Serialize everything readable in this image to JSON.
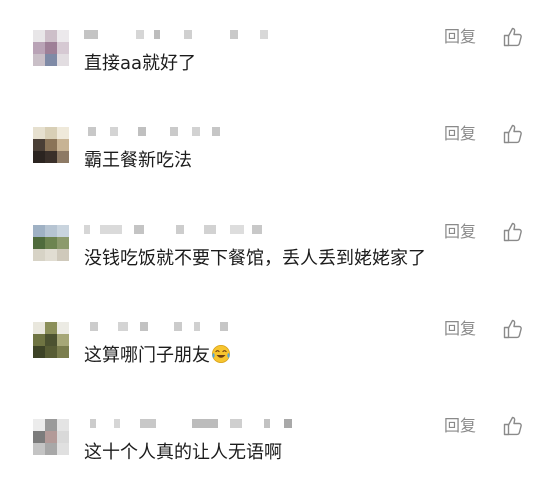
{
  "comments": [
    {
      "text": "直接aa就好了",
      "reply_label": "回复",
      "like_icon": "thumbs-up-icon"
    },
    {
      "text": "霸王餐新吃法",
      "reply_label": "回复",
      "like_icon": "thumbs-up-icon"
    },
    {
      "text": "没钱吃饭就不要下餐馆，丢人丢到姥姥家了",
      "reply_label": "回复",
      "like_icon": "thumbs-up-icon"
    },
    {
      "text": "这算哪门子朋友",
      "reply_label": "回复",
      "like_icon": "thumbs-up-icon",
      "emoji": "laughing-crying-face-icon"
    },
    {
      "text": "这十个人真的让人无语啊",
      "reply_label": "回复",
      "like_icon": "thumbs-up-icon"
    }
  ],
  "colors": {
    "text": "#1c1c1c",
    "secondary": "#8a8a8a",
    "username_mosaic": "#cfcfcf",
    "background": "#ffffff"
  }
}
